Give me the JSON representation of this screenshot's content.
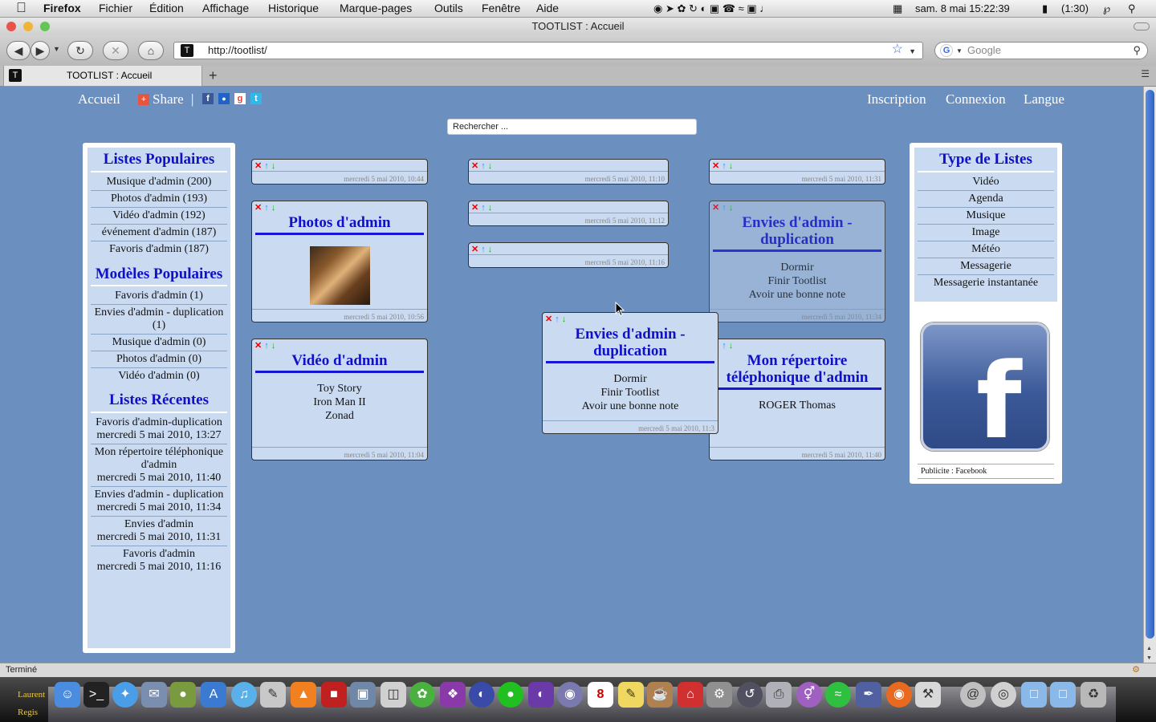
{
  "menubar": {
    "app": "Firefox",
    "items": [
      "Fichier",
      "Édition",
      "Affichage",
      "Historique",
      "Marque-pages",
      "Outils",
      "Fenêtre",
      "Aide"
    ],
    "clock": "sam. 8 mai  15:22:39",
    "battery": "(1:30)"
  },
  "window": {
    "title": "TOOTLIST : Accueil"
  },
  "browser": {
    "url": "http://tootlist/",
    "search_placeholder": "Google",
    "tab_title": "TOOTLIST : Accueil",
    "status": "Terminé"
  },
  "nav": {
    "home": "Accueil",
    "share": "Share",
    "separator": "|",
    "register": "Inscription",
    "login": "Connexion",
    "language": "Langue"
  },
  "search": {
    "value": "Rechercher ..."
  },
  "left": {
    "popular_title": "Listes Populaires",
    "popular": [
      "Musique d'admin (200)",
      "Photos d'admin (193)",
      "Vidéo d'admin (192)",
      "événement d'admin (187)",
      "Favoris d'admin (187)"
    ],
    "models_title": "Modèles Populaires",
    "models": [
      "Favoris d'admin (1)",
      "Envies d'admin - duplication (1)",
      "Musique d'admin (0)",
      "Photos d'admin (0)",
      "Vidéo d'admin (0)"
    ],
    "recent_title": "Listes Récentes",
    "recent": [
      {
        "name": "Favoris d'admin-duplication",
        "date": "mercredi 5 mai 2010, 13:27"
      },
      {
        "name": "Mon répertoire téléphonique d'admin",
        "date": "mercredi 5 mai 2010, 11:40"
      },
      {
        "name": "Envies d'admin - duplication",
        "date": "mercredi 5 mai 2010, 11:34"
      },
      {
        "name": "Envies d'admin",
        "date": "mercredi 5 mai 2010, 11:31"
      },
      {
        "name": "Favoris d'admin",
        "date": "mercredi 5 mai 2010, 11:16"
      }
    ]
  },
  "right": {
    "types_title": "Type de Listes",
    "types": [
      "Vidéo",
      "Agenda",
      "Musique",
      "Image",
      "Météo",
      "Messagerie",
      "Messagerie instantanée"
    ],
    "ad_caption": "Publicite : Facebook"
  },
  "cards": {
    "c1": {
      "date": "mercredi 5 mai 2010, 10:44"
    },
    "c2": {
      "title": "Photos d'admin",
      "date": "mercredi 5 mai 2010, 10:56"
    },
    "c3": {
      "title": "Vidéo d'admin",
      "items": [
        "Toy Story",
        "Iron Man II",
        "Zonad"
      ],
      "date": "mercredi 5 mai 2010, 11:04"
    },
    "c4": {
      "date": "mercredi 5 mai 2010, 11:10"
    },
    "c5": {
      "date": "mercredi 5 mai 2010, 11:12"
    },
    "c6": {
      "date": "mercredi 5 mai 2010, 11:16"
    },
    "c7": {
      "date": "mercredi 5 mai 2010, 11:31"
    },
    "c8": {
      "title": "Envies d'admin - duplication",
      "items": [
        "Dormir",
        "Finir Tootlist",
        "Avoir une bonne note"
      ],
      "date": "mercredi 5 mai 2010, 11:34"
    },
    "c9": {
      "title": "Envies d'admin - duplication",
      "items": [
        "Dormir",
        "Finir Tootlist",
        "Avoir une bonne note"
      ],
      "date": "mercredi 5 mai 2010, 11:3"
    },
    "c10": {
      "title": "Mon répertoire téléphonique d'admin",
      "items": [
        "ROGER Thomas"
      ],
      "date": "mercredi 5 mai 2010, 11:40"
    }
  },
  "dock": {
    "users": [
      "Laurent",
      "Regis"
    ]
  },
  "colors": {
    "page_bg": "#6b8fbe",
    "panel_bg": "#c9daf1",
    "title_blue": "#1010c8"
  }
}
